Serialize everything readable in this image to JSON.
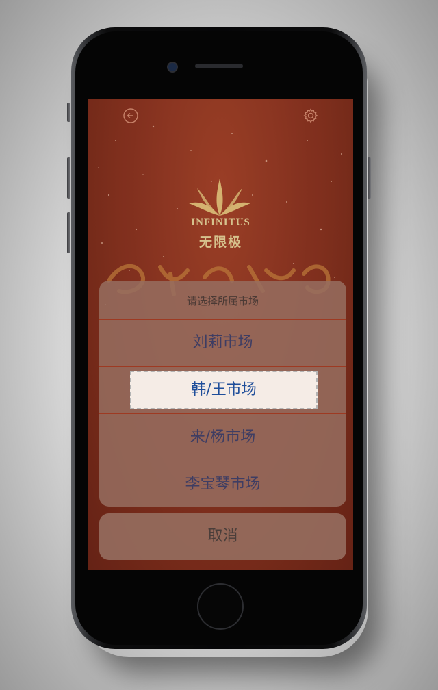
{
  "app": {
    "brand_en": "INFINITUS",
    "brand_cn": "无限极"
  },
  "icons": {
    "back": "back-circle-arrow-icon",
    "settings": "gear-icon"
  },
  "colors": {
    "screen_bg": "#8a3320",
    "sheet_bg": "#967060",
    "divider": "#9e3a22",
    "item_text": "#3e3d63",
    "selected_text": "#1f4e9a",
    "selected_bg": "#f5ece6",
    "logo_gold": "#e9d39a"
  },
  "action_sheet": {
    "title": "请选择所属市场",
    "items": [
      {
        "label": "刘莉市场",
        "selected": false
      },
      {
        "label": "韩/王市场",
        "selected": true
      },
      {
        "label": "来/杨市场",
        "selected": false
      },
      {
        "label": "李宝琴市场",
        "selected": false
      }
    ],
    "cancel_label": "取消"
  }
}
